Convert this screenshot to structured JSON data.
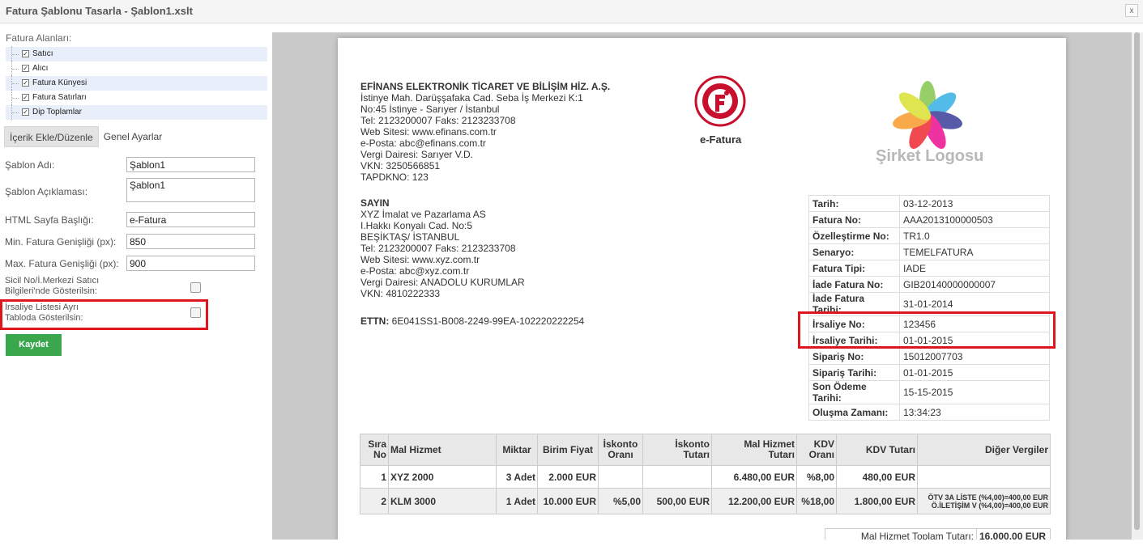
{
  "window": {
    "title": "Fatura Şablonu Tasarla - Şablon1.xslt",
    "close_label": "x"
  },
  "left": {
    "fields_label": "Fatura Alanları:",
    "tree": [
      "Satıcı",
      "Alıcı",
      "Fatura Künyesi",
      "Fatura Satırları",
      "Dip Toplamlar"
    ],
    "tabs": [
      "İçerik Ekle/Düzenle",
      "Genel Ayarlar"
    ],
    "form": {
      "template_name_label": "Şablon Adı:",
      "template_name_value": "Şablon1",
      "template_desc_label": "Şablon Açıklaması:",
      "template_desc_value": "Şablon1",
      "html_title_label": "HTML Sayfa Başlığı:",
      "html_title_value": "e-Fatura",
      "min_width_label": "Min. Fatura Genişliği (px):",
      "min_width_value": "850",
      "max_width_label": "Max. Fatura Genişliği (px):",
      "max_width_value": "900",
      "sicil_label_1": "Sicil No/İ.Merkezi Satıcı",
      "sicil_label_2": "Bilgileri'nde Gösterilsin:",
      "irsaliye_label_1": "İrsaliye Listesi Ayrı",
      "irsaliye_label_2": "Tabloda Gösterilsin:"
    },
    "save_label": "Kaydet"
  },
  "invoice": {
    "seller": {
      "name": "EFİNANS ELEKTRONİK TİCARET VE BİLİŞİM HİZ. A.Ş.",
      "lines": [
        "İstinye Mah. Darüşşafaka Cad. Seba İş Merkezi K:1",
        "No:45 İstinye - Sarıyer / İstanbul",
        "Tel: 2123200007 Faks: 2123233708",
        "Web Sitesi: www.efinans.com.tr",
        "e-Posta: abc@efinans.com.tr",
        "Vergi Dairesi: Sarıyer V.D.",
        "VKN: 3250566851",
        "TAPDKNO: 123"
      ]
    },
    "buyer": {
      "heading": "SAYIN",
      "lines": [
        "XYZ İmalat ve Pazarlama AS",
        "I.Hakkı Konyalı Cad.  No:5",
        "BEŞİKTAŞ/ İSTANBUL",
        "Tel: 2123200007 Faks: 2123233708",
        "Web Sitesi: www.xyz.com.tr",
        "e-Posta: abc@xyz.com.tr",
        "Vergi Dairesi: ANADOLU KURUMLAR",
        "VKN: 4810222333"
      ]
    },
    "ettn_label": "ETTN:",
    "ettn_value": "6E041SS1-B008-2249-99EA-102220222254",
    "gib_logo_label": "e-Fatura",
    "company_logo_text": "Şirket Logosu",
    "info": [
      {
        "k": "Tarih:",
        "v": "03-12-2013"
      },
      {
        "k": "Fatura No:",
        "v": "AAA2013100000503"
      },
      {
        "k": "Özelleştirme No:",
        "v": "TR1.0"
      },
      {
        "k": "Senaryo:",
        "v": "TEMELFATURA"
      },
      {
        "k": "Fatura Tipi:",
        "v": "IADE"
      },
      {
        "k": "İade Fatura No:",
        "v": "GIB20140000000007"
      },
      {
        "k": "İade Fatura Tarihi:",
        "v": "31-01-2014"
      },
      {
        "k": "İrsaliye No:",
        "v": "123456"
      },
      {
        "k": "İrsaliye Tarihi:",
        "v": "01-01-2015"
      },
      {
        "k": "Sipariş No:",
        "v": "15012007703"
      },
      {
        "k": "Sipariş Tarihi:",
        "v": "01-01-2015"
      },
      {
        "k": "Son Ödeme Tarihi:",
        "v": "15-15-2015"
      },
      {
        "k": "Oluşma Zamanı:",
        "v": "13:34:23"
      }
    ],
    "lines_header": {
      "sira1": "Sıra",
      "sira2": "No",
      "mal": "Mal Hizmet",
      "miktar": "Miktar",
      "birim": "Birim Fiyat",
      "isk_oran1": "İskonto",
      "isk_oran2": "Oranı",
      "isk_tutar1": "İskonto",
      "isk_tutar2": "Tutarı",
      "mal_tutar1": "Mal Hizmet",
      "mal_tutar2": "Tutarı",
      "kdv_oran1": "KDV",
      "kdv_oran2": "Oranı",
      "kdv_tutar": "KDV Tutarı",
      "diger": "Diğer Vergiler"
    },
    "rows": [
      {
        "no": "1",
        "mal": "XYZ 2000",
        "miktar": "3 Adet",
        "birim": "2.000 EUR",
        "isk_oran": "",
        "isk_tutar": "",
        "mal_tutar": "6.480,00 EUR",
        "kdv_oran": "%8,00",
        "kdv_tutar": "480,00 EUR",
        "diger1": "",
        "diger2": ""
      },
      {
        "no": "2",
        "mal": "KLM 3000",
        "miktar": "1 Adet",
        "birim": "10.000 EUR",
        "isk_oran": "%5,00",
        "isk_tutar": "500,00 EUR",
        "mal_tutar": "12.200,00 EUR",
        "kdv_oran": "%18,00",
        "kdv_tutar": "1.800,00 EUR",
        "diger1": "ÖTV 3A LİSTE (%4,00)=400,00 EUR",
        "diger2": "Ö.İLETİŞİM V (%4,00)=400,00 EUR"
      }
    ],
    "total_label": "Mal Hizmet Toplam Tutarı:",
    "total_value": "16.000,00 EUR"
  }
}
